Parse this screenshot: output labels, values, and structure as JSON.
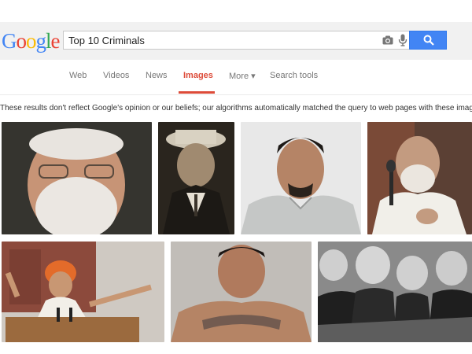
{
  "logo": {
    "letters": [
      "G",
      "o",
      "o",
      "g",
      "l",
      "e"
    ],
    "colors": [
      "#4285f4",
      "#ea4335",
      "#fbbc05",
      "#4285f4",
      "#34a853",
      "#ea4335"
    ]
  },
  "search": {
    "value": "Top 10 Criminals"
  },
  "tabs": [
    {
      "label": "Web"
    },
    {
      "label": "Videos"
    },
    {
      "label": "News"
    },
    {
      "label": "Images"
    },
    {
      "label": "More ▾"
    },
    {
      "label": "Search tools"
    }
  ],
  "notice": "These results don't reflect Google's opinion or our beliefs; our algorithms automatically matched the query to web pages with these images.",
  "colors": {
    "accent": "#dd4b39",
    "button": "#4285f4"
  },
  "images": [
    {
      "name": "result-image-1",
      "color": "#8a6b56"
    },
    {
      "name": "result-image-2",
      "color": "#6f6454"
    },
    {
      "name": "result-image-3",
      "color": "#b9b6b2"
    },
    {
      "name": "result-image-4",
      "color": "#b89f8d"
    },
    {
      "name": "result-image-5",
      "color": "#c9a27e"
    },
    {
      "name": "result-image-6",
      "color": "#a58672"
    },
    {
      "name": "result-image-7",
      "color": "#7d7d7d"
    }
  ]
}
